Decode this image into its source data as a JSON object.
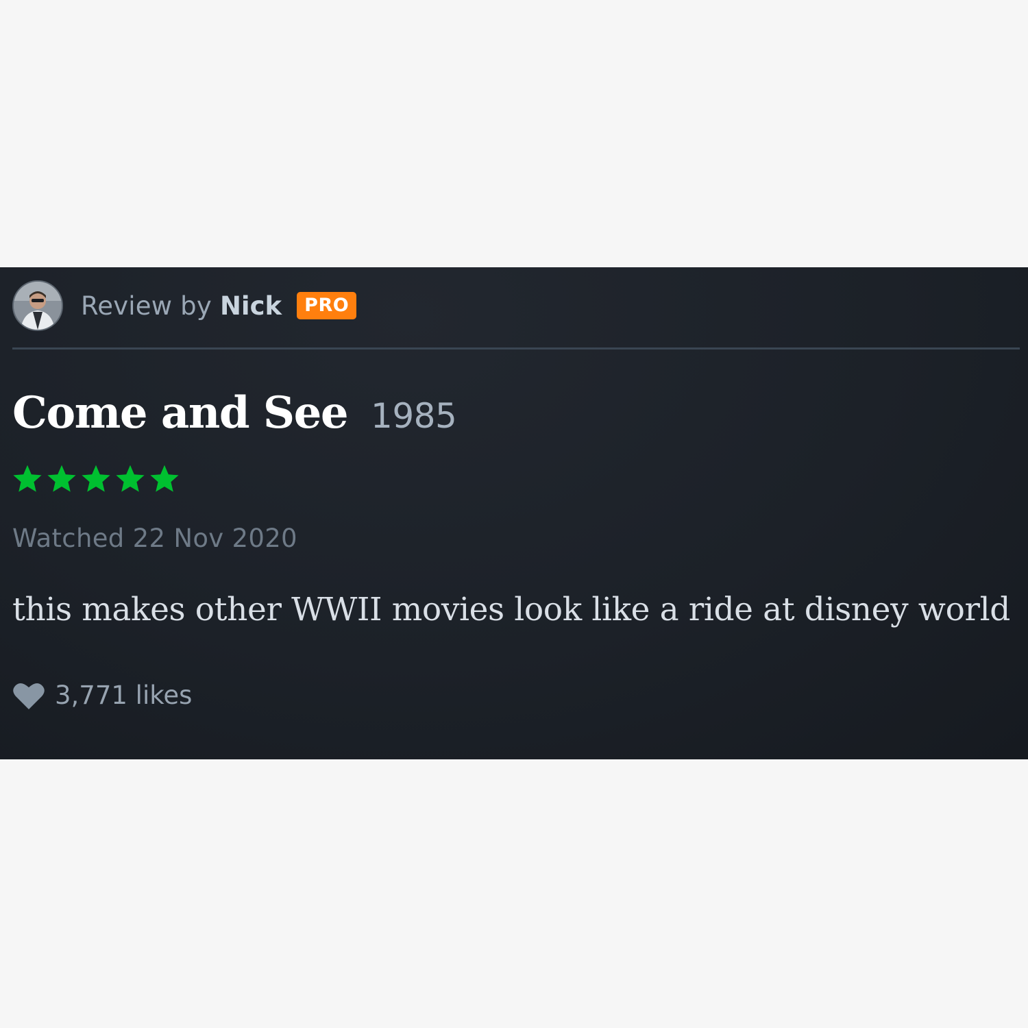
{
  "review": {
    "prefix": "Review by",
    "author": "Nick",
    "badge": "PRO",
    "avatar_icon": "user-avatar",
    "badge_color": "#ff7f0e"
  },
  "film": {
    "title": "Come and See",
    "year": "1985"
  },
  "rating": {
    "stars": 5,
    "max_stars": 5,
    "color": "#00c030",
    "icon": "star-icon"
  },
  "watched": "Watched 22 Nov 2020",
  "body": "this makes other WWII movies look like a ride at disney world",
  "likes": {
    "icon": "heart-icon",
    "label": "3,771 likes"
  }
}
